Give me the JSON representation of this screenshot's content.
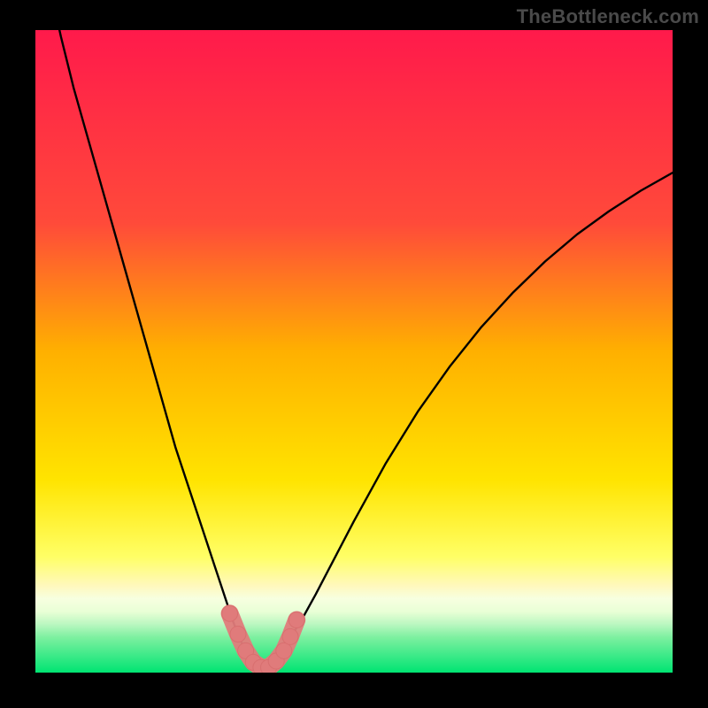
{
  "watermark": "TheBottleneck.com",
  "colors": {
    "black": "#000000",
    "curve": "#000000",
    "marker_fill": "#e07b7b",
    "marker_stroke": "#d86f6f",
    "grad_top": "#ff1a4b",
    "grad_mid_top": "#ff7a2a",
    "grad_mid": "#ffe400",
    "grad_band_light": "#fff8bd",
    "grad_band_pale": "#e9ffd6",
    "grad_bottom": "#00e472"
  },
  "chart_data": {
    "type": "line",
    "title": "",
    "xlabel": "",
    "ylabel": "",
    "xlim": [
      0,
      100
    ],
    "ylim": [
      0,
      100
    ],
    "series": [
      {
        "name": "bottleneck-curve",
        "x": [
          0,
          2,
          4,
          6,
          8,
          10,
          12,
          14,
          16,
          18,
          20,
          22,
          24,
          26,
          28,
          30,
          31,
          32,
          33,
          34,
          35,
          36,
          37,
          38,
          40,
          42,
          44,
          46,
          50,
          55,
          60,
          65,
          70,
          75,
          80,
          85,
          90,
          95,
          100
        ],
        "y": [
          118,
          108,
          99,
          91,
          84,
          77,
          70,
          63,
          56,
          49,
          42,
          35,
          29,
          23,
          17,
          11,
          8,
          5.5,
          3.2,
          1.6,
          0.6,
          0.6,
          1.4,
          2.6,
          5.4,
          8.6,
          12.2,
          16,
          23.6,
          32.6,
          40.6,
          47.6,
          53.8,
          59.2,
          64,
          68.2,
          71.8,
          75,
          77.8
        ]
      }
    ],
    "markers": {
      "name": "highlight-points",
      "x": [
        30.5,
        31.8,
        33.0,
        34.2,
        35.4,
        36.6,
        37.8,
        39.0,
        40.0,
        41.0
      ],
      "y": [
        9.2,
        6.0,
        3.4,
        1.6,
        0.8,
        0.8,
        1.8,
        3.4,
        5.6,
        8.2
      ],
      "r": 9
    }
  }
}
